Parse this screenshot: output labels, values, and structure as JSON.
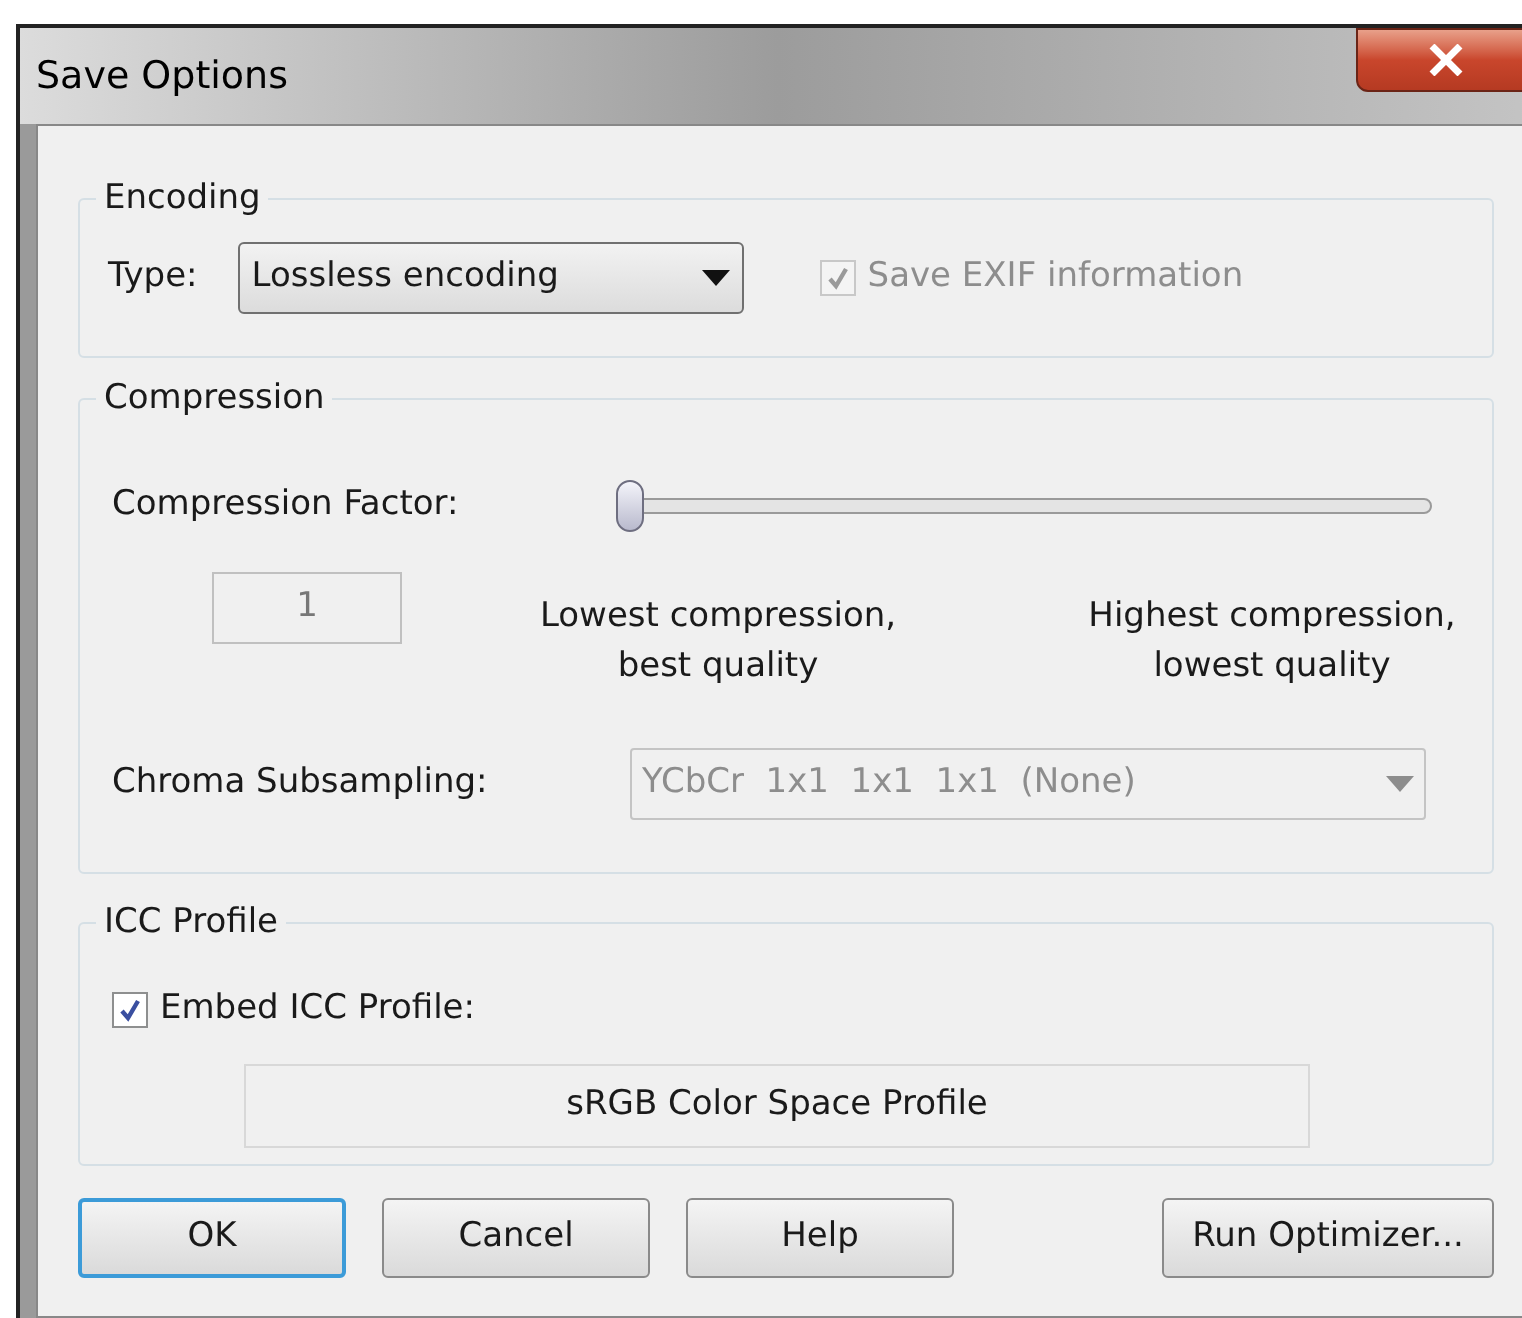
{
  "window": {
    "title": "Save Options"
  },
  "encoding": {
    "title": "Encoding",
    "type_label": "Type:",
    "type_value": "Lossless encoding",
    "exif": {
      "label": "Save EXIF information",
      "checked": true,
      "disabled": true
    }
  },
  "compression": {
    "title": "Compression",
    "factor_label": "Compression Factor:",
    "factor": {
      "level": 0,
      "value": "1",
      "disabled": true
    },
    "low_label": "Lowest compression,\nbest quality",
    "high_label": "Highest compression,\nlowest quality",
    "chroma_label": "Chroma Subsampling:",
    "chroma": {
      "value": "YCbCr  1x1  1x1  1x1  (None)",
      "disabled": true
    }
  },
  "icc": {
    "title": "ICC Profile",
    "embed": {
      "label": "Embed ICC Profile:",
      "checked": true,
      "disabled": false
    },
    "profile": "sRGB Color Space Profile"
  },
  "buttons": [
    {
      "label": "OK",
      "selected": true
    },
    {
      "label": "Cancel",
      "selected": false
    },
    {
      "label": "Help",
      "selected": false
    },
    {
      "label": "Run Optimizer...",
      "selected": false
    }
  ]
}
